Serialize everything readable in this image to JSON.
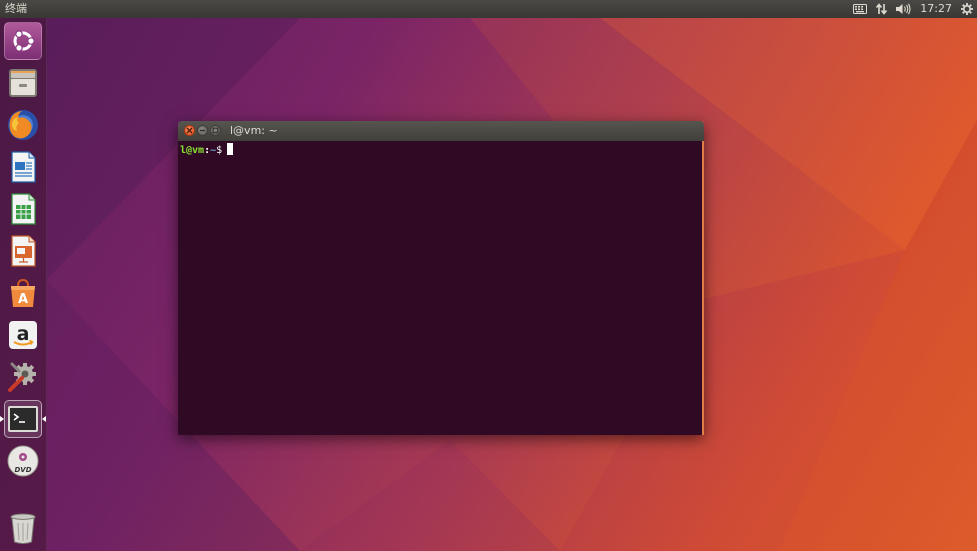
{
  "top_panel": {
    "app_title": "终端",
    "clock": "17:27",
    "icons": [
      "keyboard-icon",
      "network-arrows-icon",
      "volume-icon",
      "power-gear-icon"
    ]
  },
  "launcher": {
    "items": [
      {
        "name": "dash-home",
        "icon": "ubuntu-logo-icon"
      },
      {
        "name": "files",
        "icon": "file-cabinet-icon"
      },
      {
        "name": "firefox",
        "icon": "firefox-icon"
      },
      {
        "name": "libreoffice-writer",
        "icon": "writer-document-icon"
      },
      {
        "name": "libreoffice-calc",
        "icon": "calc-spreadsheet-icon"
      },
      {
        "name": "libreoffice-impress",
        "icon": "impress-presentation-icon"
      },
      {
        "name": "ubuntu-software",
        "icon": "software-bag-icon"
      },
      {
        "name": "amazon",
        "icon": "amazon-icon"
      },
      {
        "name": "system-settings",
        "icon": "settings-tools-icon"
      },
      {
        "name": "terminal",
        "icon": "terminal-icon",
        "active": true
      },
      {
        "name": "dvd",
        "icon": "dvd-disc-icon"
      },
      {
        "name": "trash",
        "icon": "trash-icon"
      }
    ]
  },
  "terminal": {
    "window_title": "l@vm: ~",
    "prompt_user": "l@vm",
    "prompt_sep": ":",
    "prompt_path": "~",
    "prompt_dollar": "$",
    "input": ""
  },
  "colors": {
    "terminal_bg": "#300a24",
    "prompt_green": "#8ae234",
    "prompt_blue": "#729fcf",
    "close_orange": "#e0501f",
    "panel": "#3c3b37"
  }
}
